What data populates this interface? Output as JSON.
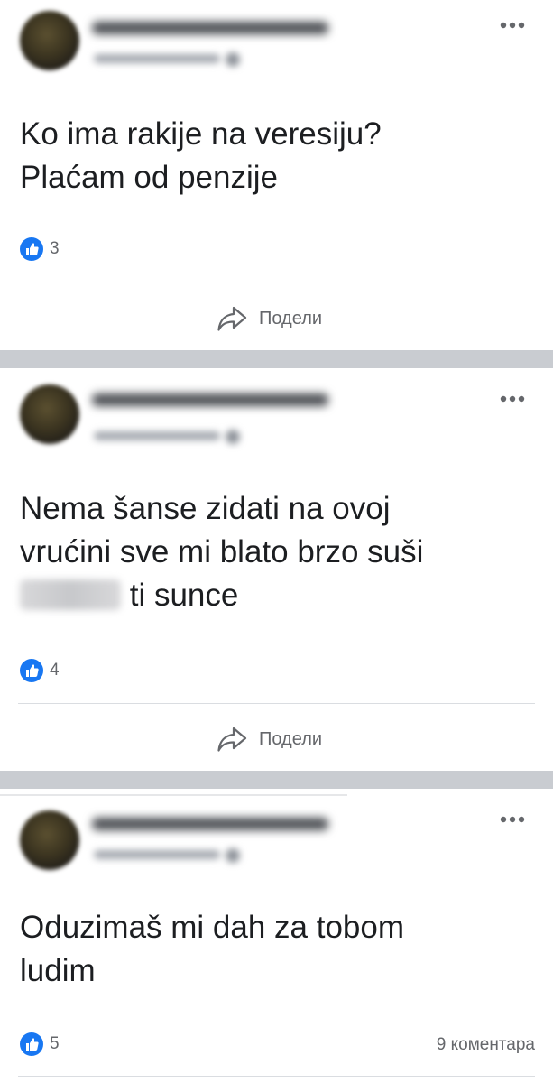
{
  "theme": {
    "like_color": "#1877f2",
    "text_color": "#1c1e21",
    "secondary_text_color": "#65676b",
    "separator_color": "#c9ccd1"
  },
  "posts": [
    {
      "text_lines": [
        "Ko ima rakije na veresiju?",
        "Plaćam od penzije"
      ],
      "like_count": "3",
      "share_label": "Подели",
      "avatar_icon": "avatar",
      "more_icon": "more-horizontal-icon"
    },
    {
      "text_lines": [
        "Nema šanse zidati na ovoj",
        "vrućini sve mi blato brzo suši"
      ],
      "text_line_3_suffix": "ti sunce",
      "like_count": "4",
      "share_label": "Подели",
      "avatar_icon": "avatar",
      "more_icon": "more-horizontal-icon"
    },
    {
      "text_lines": [
        "Oduzimaš mi dah za tobom",
        "ludim"
      ],
      "like_count": "5",
      "comments_label": "9 коментара",
      "avatar_icon": "avatar",
      "more_icon": "more-horizontal-icon"
    }
  ]
}
